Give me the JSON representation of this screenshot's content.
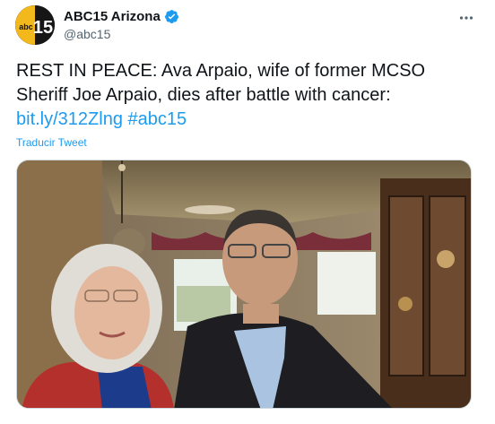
{
  "account": {
    "display_name": "ABC15 Arizona",
    "handle": "@abc15",
    "avatar_text": "15",
    "avatar_small": "abc",
    "verified": true
  },
  "tweet": {
    "text_line1": "REST IN PEACE: Ava Arpaio, wife of former MCSO",
    "text_line2": "Sheriff Joe Arpaio, dies after battle with cancer:",
    "link": "bit.ly/312Zlng",
    "hashtag": "#abc15",
    "translate_label": "Traducir Tweet"
  },
  "icons": {
    "verified": "verified-badge-icon",
    "more": "more-options-icon"
  },
  "colors": {
    "link": "#1d9bf0",
    "verified": "#1d9bf0",
    "handle": "#536471"
  }
}
